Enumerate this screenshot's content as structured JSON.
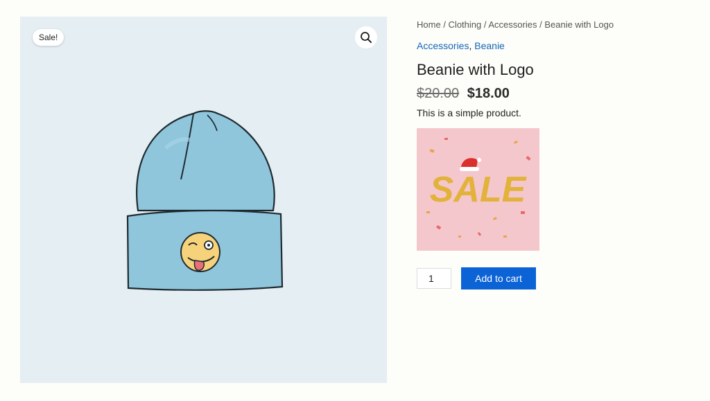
{
  "gallery": {
    "sale_badge": "Sale!",
    "zoom_icon": "magnifier-icon"
  },
  "breadcrumb": {
    "items": [
      "Home",
      "Clothing",
      "Accessories",
      "Beanie with Logo"
    ],
    "separator": "/"
  },
  "categories": {
    "items": [
      "Accessories",
      "Beanie"
    ],
    "separator": ","
  },
  "product": {
    "title": "Beanie with Logo",
    "old_price": "$20.00",
    "price": "$18.00",
    "description": "This is a simple product."
  },
  "promo_image": {
    "text": "SALE"
  },
  "cart": {
    "quantity": "1",
    "add_label": "Add to cart"
  },
  "colors": {
    "accent": "#0b63d6",
    "link": "#1467b8",
    "gallery_bg": "#e5eef2",
    "promo_bg": "#f4c7cd",
    "promo_text": "#e2b23a"
  }
}
